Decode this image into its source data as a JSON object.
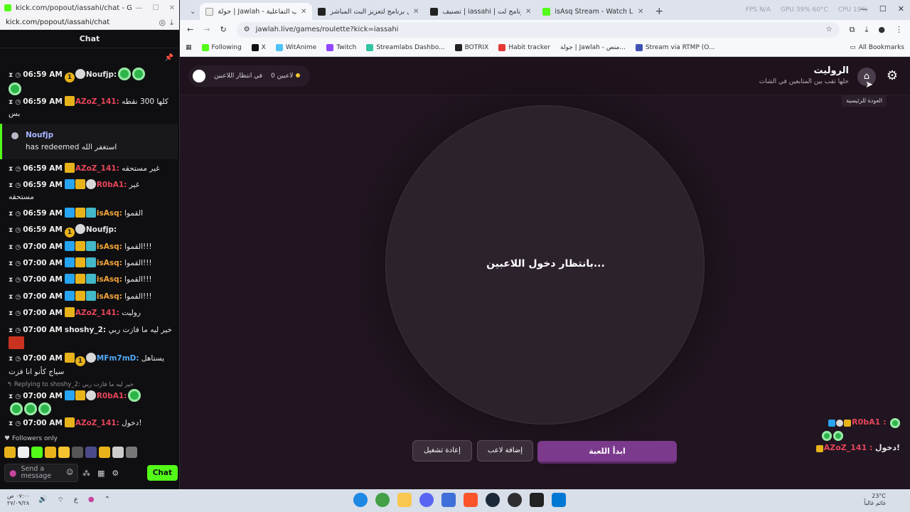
{
  "kick_window": {
    "title": "kick.com/popout/iassahi/chat - Googl...",
    "url": "kick.com/popout/iassahi/chat",
    "chat_header": "Chat",
    "messages": [
      {
        "time": "06:59 AM",
        "user": "Noufjp:",
        "text": ""
      },
      {
        "time": "06:59 AM",
        "user": "AZoZ_141:",
        "text": "كلها 300 نقطه",
        "text2": "بس"
      },
      {
        "time": "06:59 AM",
        "user": "AZoZ_141:",
        "text": "غير مستحقه"
      },
      {
        "time": "06:59 AM",
        "user": "R0bA1:",
        "text": "غير",
        "text2": "مستحقه"
      },
      {
        "time": "06:59 AM",
        "user": "isAsq:",
        "text": "القموا"
      },
      {
        "time": "06:59 AM",
        "user": "Noufjp:",
        "text": ""
      },
      {
        "time": "07:00 AM",
        "user": "isAsq:",
        "text": "القموا!!!"
      },
      {
        "time": "07:00 AM",
        "user": "isAsq:",
        "text": "القموا!!!"
      },
      {
        "time": "07:00 AM",
        "user": "isAsq:",
        "text": "القموا!!!"
      },
      {
        "time": "07:00 AM",
        "user": "isAsq:",
        "text": "القموا!!!"
      },
      {
        "time": "07:00 AM",
        "user": "AZoZ_141:",
        "text": "روليت"
      },
      {
        "time": "07:00 AM",
        "user": "shoshy_2:",
        "text": "خير ليه ما فازت ربي"
      },
      {
        "time": "07:00 AM",
        "user": "MFm7mD:",
        "text": "يستاهل",
        "text2": "سياج كأنو انا فزت"
      },
      {
        "time": "07:00 AM",
        "user": "R0bA1:",
        "text": ""
      },
      {
        "time": "07:00 AM",
        "user": "AZoZ_141:",
        "text": "دخول!"
      }
    ],
    "redeem": {
      "user": "Noufjp",
      "text": "has redeemed استغفر الله"
    },
    "reply_label": "Replying to shoshy_2: خير ليه ما فازت ربي",
    "followers_only": "Followers only",
    "input_placeholder": "Send a message",
    "chat_button": "Chat"
  },
  "browser": {
    "tabs": [
      {
        "title": "جولة | Jawlah - منصة الألعاب التفاعلية",
        "color": "#f5f5f5"
      },
      {
        "title": "الوك | أفضل برنامج لتعزيز البث المباشر",
        "color": "#222222"
      },
      {
        "title": "تصنيف | iassahi | أفضل برنامج لت...",
        "color": "#222222"
      },
      {
        "title": "isAsq Stream - Watch Live on Kick",
        "color": "#53fc18"
      }
    ],
    "sys_stats": {
      "fps": "FPS N/A",
      "gpu": "GPU 39% 60°C",
      "cpu": "CPU 19%"
    },
    "url": "jawlah.live/games/roulette?kick=iassahi",
    "bookmarks": [
      {
        "label": "Following",
        "color": "#53fc18"
      },
      {
        "label": "X",
        "color": "#111111"
      },
      {
        "label": "WitAnime",
        "color": "#4fc3f7"
      },
      {
        "label": "Twitch",
        "color": "#9146ff"
      },
      {
        "label": "Streamlabs Dashbo...",
        "color": "#31c3a2"
      },
      {
        "label": "BOTRIX",
        "color": "#222222"
      },
      {
        "label": "Habit tracker",
        "color": "#e53935"
      },
      {
        "label": "جولة | Jawlah - منص...",
        "color": "#f5f5f5"
      },
      {
        "label": "Stream via RTMP (O...",
        "color": "#3f51b5"
      }
    ],
    "all_bookmarks": "All Bookmarks"
  },
  "page": {
    "title": "الروليت",
    "subtitle": "خلها تقب بين المتابعين في الشات",
    "home_tooltip": "العودة للرئيسية",
    "status_waiting": "في انتظار اللاعبين",
    "player_count": "0 لاعبين",
    "wheel_text": "بانتظار دخول اللاعبين...",
    "btn_start": "ابدأ اللعبة",
    "btn_add": "إضافة لاعب",
    "btn_restart": "إعادة تشغيل",
    "overlay": [
      {
        "user": "R0bA1 :",
        "text": ""
      },
      {
        "user": "AZoZ_141 :",
        "text": "دخول!"
      }
    ]
  },
  "taskbar": {
    "time": "٠٧:٠٠ ص",
    "date": "٢٧/٠٩/٢٨",
    "lang": "ع",
    "weather_temp": "23°C",
    "weather_desc": "غائم غالباً"
  },
  "colors": {
    "kick_green": "#53fc18",
    "page_bg": "#201520",
    "start_btn": "#7b3a8c"
  }
}
